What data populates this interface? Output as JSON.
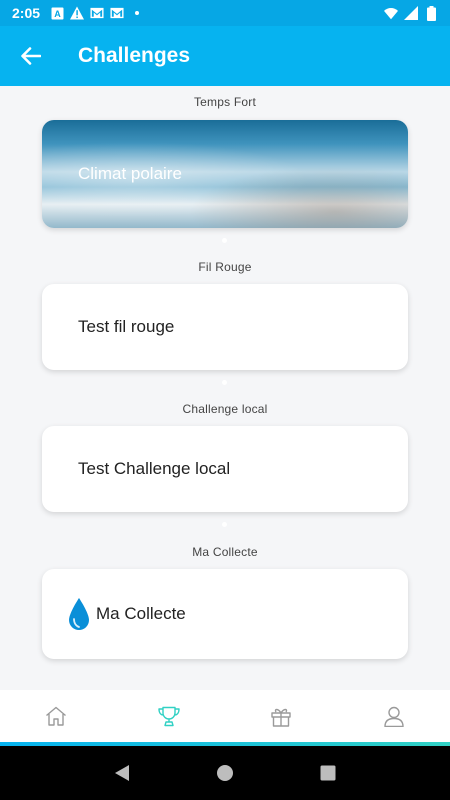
{
  "status_bar": {
    "time": "2:05",
    "icons": [
      "a-box-icon",
      "alert-icon",
      "gmail-icon",
      "gmail-icon",
      "dot-icon",
      "wifi-icon",
      "signal-icon",
      "battery-icon"
    ]
  },
  "app_bar": {
    "title": "Challenges",
    "back_icon": "arrow-left-icon"
  },
  "sections": [
    {
      "label": "Temps Fort",
      "card_title": "Climat polaire"
    },
    {
      "label": "Fil Rouge",
      "card_title": "Test fil rouge"
    },
    {
      "label": "Challenge local",
      "card_title": "Test Challenge local"
    },
    {
      "label": "Ma Collecte",
      "card_title": "Ma Collecte",
      "icon": "water-drop-icon"
    }
  ],
  "bottom_nav": {
    "items": [
      {
        "name": "home",
        "icon": "home-icon",
        "active": false
      },
      {
        "name": "challenges",
        "icon": "trophy-icon",
        "active": true
      },
      {
        "name": "rewards",
        "icon": "gift-icon",
        "active": false
      },
      {
        "name": "profile",
        "icon": "user-icon",
        "active": false
      }
    ]
  },
  "colors": {
    "primary": "#06b3f0",
    "status_bar": "#06a7e5",
    "accent": "#31d1c4",
    "background": "#f5f6f8",
    "drop": "#0a8fd8"
  }
}
